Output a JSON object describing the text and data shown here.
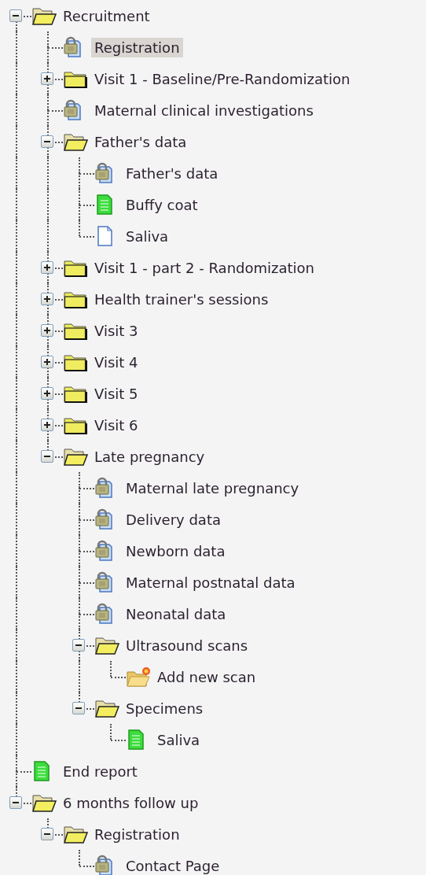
{
  "tree": [
    {
      "label": "Recruitment",
      "kind": "folder",
      "expanded": true,
      "selected": false,
      "children": [
        {
          "label": "Registration",
          "kind": "locked",
          "selected": true
        },
        {
          "label": "Visit 1 - Baseline/Pre-Randomization",
          "kind": "folder",
          "expanded": false,
          "selected": false
        },
        {
          "label": "Maternal clinical investigations",
          "kind": "locked",
          "selected": false
        },
        {
          "label": "Father's data",
          "kind": "folder",
          "expanded": true,
          "selected": false,
          "children": [
            {
              "label": "Father's data",
              "kind": "locked",
              "selected": false
            },
            {
              "label": "Buffy coat",
              "kind": "complete",
              "selected": false
            },
            {
              "label": "Saliva",
              "kind": "empty",
              "selected": false
            }
          ]
        },
        {
          "label": "Visit 1 - part 2 - Randomization",
          "kind": "folder",
          "expanded": false,
          "selected": false
        },
        {
          "label": "Health trainer's sessions",
          "kind": "folder",
          "expanded": false,
          "selected": false
        },
        {
          "label": "Visit 3",
          "kind": "folder",
          "expanded": false,
          "selected": false
        },
        {
          "label": "Visit 4",
          "kind": "folder",
          "expanded": false,
          "selected": false
        },
        {
          "label": "Visit 5",
          "kind": "folder",
          "expanded": false,
          "selected": false
        },
        {
          "label": "Visit 6",
          "kind": "folder",
          "expanded": false,
          "selected": false
        },
        {
          "label": "Late pregnancy",
          "kind": "folder",
          "expanded": true,
          "selected": false,
          "children": [
            {
              "label": "Maternal late pregnancy",
              "kind": "locked",
              "selected": false
            },
            {
              "label": "Delivery data",
              "kind": "locked",
              "selected": false
            },
            {
              "label": "Newborn data",
              "kind": "locked",
              "selected": false
            },
            {
              "label": "Maternal postnatal data",
              "kind": "locked",
              "selected": false
            },
            {
              "label": "Neonatal data",
              "kind": "locked",
              "selected": false
            },
            {
              "label": "Ultrasound scans",
              "kind": "folder",
              "expanded": true,
              "selected": false,
              "children": [
                {
                  "label": "Add new scan",
                  "kind": "add",
                  "selected": false
                }
              ]
            },
            {
              "label": "Specimens",
              "kind": "folder",
              "expanded": true,
              "selected": false,
              "children": [
                {
                  "label": "Saliva",
                  "kind": "complete",
                  "selected": false
                }
              ]
            }
          ]
        }
      ]
    },
    {
      "label": "End report",
      "kind": "complete",
      "selected": false
    },
    {
      "label": "6 months follow up",
      "kind": "folder",
      "expanded": true,
      "selected": false,
      "children": [
        {
          "label": "Registration",
          "kind": "folder",
          "expanded": true,
          "selected": false,
          "children": [
            {
              "label": "Contact Page",
              "kind": "locked",
              "selected": false
            }
          ]
        }
      ]
    }
  ]
}
